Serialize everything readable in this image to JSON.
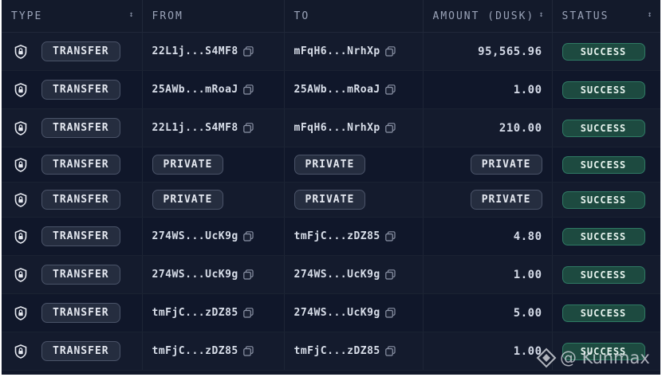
{
  "headers": {
    "type": "TYPE",
    "from": "FROM",
    "to": "TO",
    "amount": "AMOUNT (DUSK)",
    "status": "STATUS",
    "sort_icon": "sort-icon"
  },
  "rows": [
    {
      "type": "TRANSFER",
      "icon": "shield-icon",
      "from": "22L1j...S4MF8",
      "from_private": false,
      "to": "mFqH6...NrhXp",
      "to_private": false,
      "amount": "95,565.96",
      "amount_private": false,
      "status": "SUCCESS"
    },
    {
      "type": "TRANSFER",
      "icon": "shield-icon",
      "from": "25AWb...mRoaJ",
      "from_private": false,
      "to": "25AWb...mRoaJ",
      "to_private": false,
      "amount": "1.00",
      "amount_private": false,
      "status": "SUCCESS"
    },
    {
      "type": "TRANSFER",
      "icon": "shield-icon",
      "from": "22L1j...S4MF8",
      "from_private": false,
      "to": "mFqH6...NrhXp",
      "to_private": false,
      "amount": "210.00",
      "amount_private": false,
      "status": "SUCCESS"
    },
    {
      "type": "TRANSFER",
      "icon": "shield-icon",
      "from": "PRIVATE",
      "from_private": true,
      "to": "PRIVATE",
      "to_private": true,
      "amount": "PRIVATE",
      "amount_private": true,
      "status": "SUCCESS"
    },
    {
      "type": "TRANSFER",
      "icon": "shield-icon",
      "from": "PRIVATE",
      "from_private": true,
      "to": "PRIVATE",
      "to_private": true,
      "amount": "PRIVATE",
      "amount_private": true,
      "status": "SUCCESS"
    },
    {
      "type": "TRANSFER",
      "icon": "shield-icon",
      "from": "274WS...UcK9g",
      "from_private": false,
      "to": "tmFjC...zDZ85",
      "to_private": false,
      "amount": "4.80",
      "amount_private": false,
      "status": "SUCCESS"
    },
    {
      "type": "TRANSFER",
      "icon": "shield-icon",
      "from": "274WS...UcK9g",
      "from_private": false,
      "to": "274WS...UcK9g",
      "to_private": false,
      "amount": "1.00",
      "amount_private": false,
      "status": "SUCCESS"
    },
    {
      "type": "TRANSFER",
      "icon": "shield-icon",
      "from": "tmFjC...zDZ85",
      "from_private": false,
      "to": "274WS...UcK9g",
      "to_private": false,
      "amount": "5.00",
      "amount_private": false,
      "status": "SUCCESS"
    },
    {
      "type": "TRANSFER",
      "icon": "shield-icon",
      "from": "tmFjC...zDZ85",
      "from_private": false,
      "to": "tmFjC...zDZ85",
      "to_private": false,
      "amount": "1.00",
      "amount_private": false,
      "status": "SUCCESS"
    }
  ],
  "watermark": "@ Kunmax",
  "colors": {
    "background": "#12182a",
    "status_bg": "#1d4a40",
    "status_border": "#2f7a64",
    "pill_bg": "#252d3f"
  }
}
